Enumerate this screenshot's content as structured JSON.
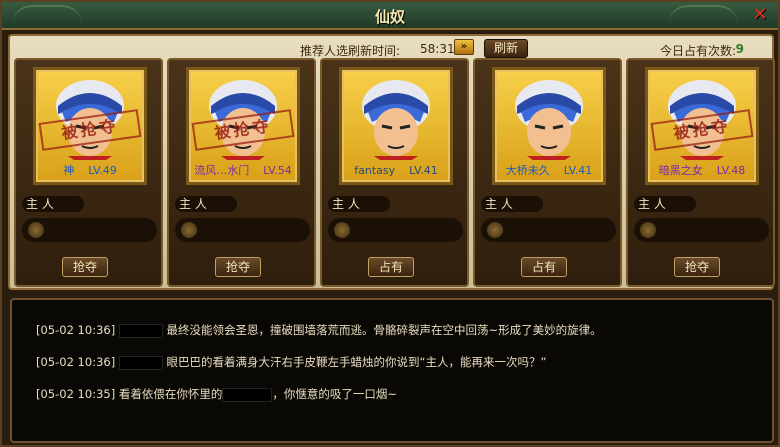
{
  "window": {
    "title": "仙奴",
    "close_icon": "close-x-icon"
  },
  "header": {
    "refresh_label": "推荐人选刷新时间:",
    "refresh_time": "58:31",
    "fast_forward_icon": "fast-forward-icon",
    "refresh_button": "刷新",
    "occupy_label": "今日占有次数:",
    "occupy_count": "9"
  },
  "cards": [
    {
      "name": "神",
      "level": "LV.49",
      "name_color": "#1a5ac8",
      "stamp": "被抢夺",
      "owner_label": "主 人",
      "action": "抢夺"
    },
    {
      "name": "流风…水门",
      "level": "LV.54",
      "name_color": "#7a2aa8",
      "stamp": "被抢夺",
      "owner_label": "主 人",
      "action": "抢夺"
    },
    {
      "name": "fantasy",
      "level": "LV.41",
      "name_color": "#2a4a7a",
      "stamp": "",
      "owner_label": "主 人",
      "action": "占有"
    },
    {
      "name": "大桥未久",
      "level": "LV.41",
      "name_color": "#1a5ac8",
      "stamp": "",
      "owner_label": "主 人",
      "action": "占有"
    },
    {
      "name": "暗黑之女",
      "level": "LV.48",
      "name_color": "#7a2aa8",
      "stamp": "被抢夺",
      "owner_label": "主 人",
      "action": "抢夺"
    }
  ],
  "log": [
    {
      "time": "[05-02 10:36]",
      "text": "最终没能领会圣恩，撞破围墙落荒而逃。骨骼碎裂声在空中回荡~形成了美妙的旋律。"
    },
    {
      "time": "[05-02 10:36]",
      "text": "眼巴巴的看着满身大汗右手皮鞭左手蜡烛的你说到“主人，能再来一次吗？”"
    },
    {
      "time": "[05-02 10:35]",
      "text_a": "看着依偎在你怀里的",
      "text_b": "，你惬意的吸了一口烟~"
    }
  ]
}
